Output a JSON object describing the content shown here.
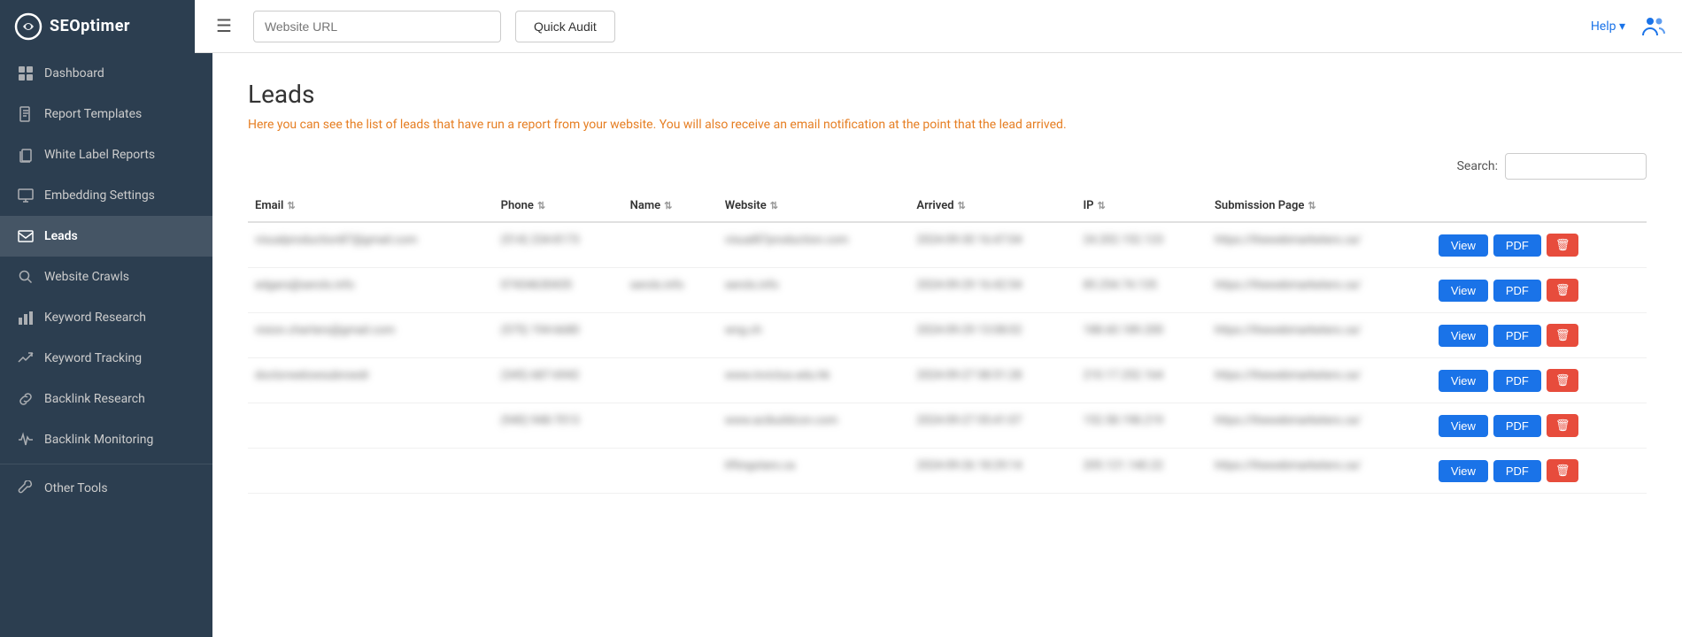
{
  "topbar": {
    "logo_text": "SEOptimer",
    "url_placeholder": "Website URL",
    "quick_audit_label": "Quick Audit",
    "help_label": "Help ▾"
  },
  "sidebar": {
    "items": [
      {
        "id": "dashboard",
        "label": "Dashboard",
        "icon": "grid-icon",
        "active": false
      },
      {
        "id": "report-templates",
        "label": "Report Templates",
        "icon": "file-icon",
        "active": false
      },
      {
        "id": "white-label-reports",
        "label": "White Label Reports",
        "icon": "copy-icon",
        "active": false
      },
      {
        "id": "embedding-settings",
        "label": "Embedding Settings",
        "icon": "monitor-icon",
        "active": false
      },
      {
        "id": "leads",
        "label": "Leads",
        "icon": "mail-icon",
        "active": true
      },
      {
        "id": "website-crawls",
        "label": "Website Crawls",
        "icon": "search-icon",
        "active": false
      },
      {
        "id": "keyword-research",
        "label": "Keyword Research",
        "icon": "bar-chart-icon",
        "active": false
      },
      {
        "id": "keyword-tracking",
        "label": "Keyword Tracking",
        "icon": "trending-icon",
        "active": false
      },
      {
        "id": "backlink-research",
        "label": "Backlink Research",
        "icon": "link-icon",
        "active": false
      },
      {
        "id": "backlink-monitoring",
        "label": "Backlink Monitoring",
        "icon": "activity-icon",
        "active": false
      },
      {
        "id": "other-tools",
        "label": "Other Tools",
        "icon": "tool-icon",
        "active": false
      }
    ]
  },
  "main": {
    "page_title": "Leads",
    "page_subtitle": "Here you can see the list of leads that have run a report from your website. You will also receive an email notification at the point that the lead arrived.",
    "search_label": "Search:",
    "search_placeholder": "",
    "table": {
      "columns": [
        {
          "label": "Email",
          "sortable": true
        },
        {
          "label": "Phone",
          "sortable": true
        },
        {
          "label": "Name",
          "sortable": true
        },
        {
          "label": "Website",
          "sortable": true
        },
        {
          "label": "Arrived",
          "sortable": true
        },
        {
          "label": "IP",
          "sortable": true
        },
        {
          "label": "Submission Page",
          "sortable": true
        },
        {
          "label": "",
          "sortable": true
        }
      ],
      "rows": [
        {
          "email": "visualproduction87@gmail.com",
          "phone": "(514) 234-8173",
          "name": "",
          "website": "visual87production.com",
          "arrived": "2024-09-30 16:47:04",
          "ip": "24.202.152.123",
          "submission_page": "https://thewebmarketers.ca/",
          "blurred": true
        },
        {
          "email": "edgars@serols.info",
          "phone": "07434630435",
          "name": "serols.info",
          "website": "serols.info",
          "arrived": "2024-09-29 16:42:54",
          "ip": "85.254.74.135",
          "submission_page": "https://thewebmarketers.ca/",
          "blurred": true
        },
        {
          "email": "vision.charters@gmail.com",
          "phone": "(575) 194-6680",
          "name": "",
          "website": "wng.ch",
          "arrived": "2024-09-29 13:08:02",
          "ip": "188.60.189.200",
          "submission_page": "https://thewebmarketers.ca/",
          "blurred": true
        },
        {
          "email": "doctorwelowsubrowdr",
          "phone": "(345) 687-6942",
          "name": "",
          "website": "www.invictus.edu.hk",
          "arrived": "2024-09-27 08:51:28",
          "ip": "210.17.252.164",
          "submission_page": "https://thewebmarketers.ca/",
          "blurred": true
        },
        {
          "email": "",
          "phone": "(940) 948-7013",
          "name": "",
          "website": "www.acibuildcon.com",
          "arrived": "2024-09-27 05:41:07",
          "ip": "152.58.198.219",
          "submission_page": "https://thewebmarketers.ca/",
          "blurred": true
        },
        {
          "email": "",
          "phone": "",
          "name": "",
          "website": "liftingstars.ca",
          "arrived": "2024-09-26 18:29:14",
          "ip": "205.121.140.22",
          "submission_page": "https://thewebmarketers.ca/",
          "blurred": true
        }
      ],
      "btn_view": "View",
      "btn_pdf": "PDF"
    }
  }
}
